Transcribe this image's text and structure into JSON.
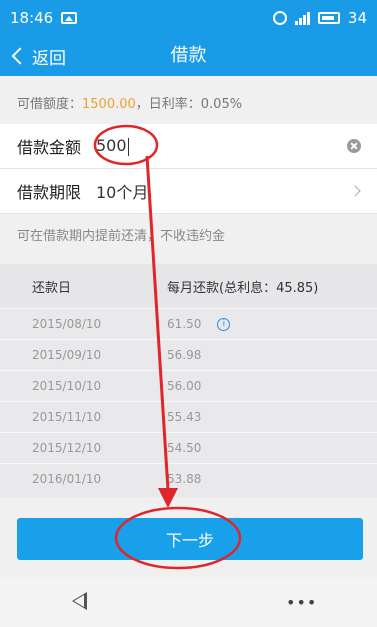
{
  "status_bar": {
    "time": "18:46",
    "battery": "34"
  },
  "nav": {
    "back_label": "返回",
    "title": "借款"
  },
  "quota": {
    "prefix": "可借额度：",
    "amount": "1500.00",
    "rate_text": "，日利率：0.05%"
  },
  "amount_row": {
    "label": "借款金额",
    "value": "500"
  },
  "term_row": {
    "label": "借款期限",
    "value": "10个月"
  },
  "tip": "可在借款期内提前还清，不收违约金",
  "schedule": {
    "headers": [
      "还款日",
      "每月还款(总利息：45.85)"
    ],
    "rows": [
      {
        "date": "2015/08/10",
        "amount": "61.50"
      },
      {
        "date": "2015/09/10",
        "amount": "56.98"
      },
      {
        "date": "2015/10/10",
        "amount": "56.00"
      },
      {
        "date": "2015/11/10",
        "amount": "55.43"
      },
      {
        "date": "2015/12/10",
        "amount": "54.50"
      },
      {
        "date": "2016/01/10",
        "amount": "53.88"
      }
    ]
  },
  "next_button": "下一步",
  "colors": {
    "brand": "#1a9be8",
    "amount_accent": "#f0a030",
    "annotation": "#e0252b"
  }
}
